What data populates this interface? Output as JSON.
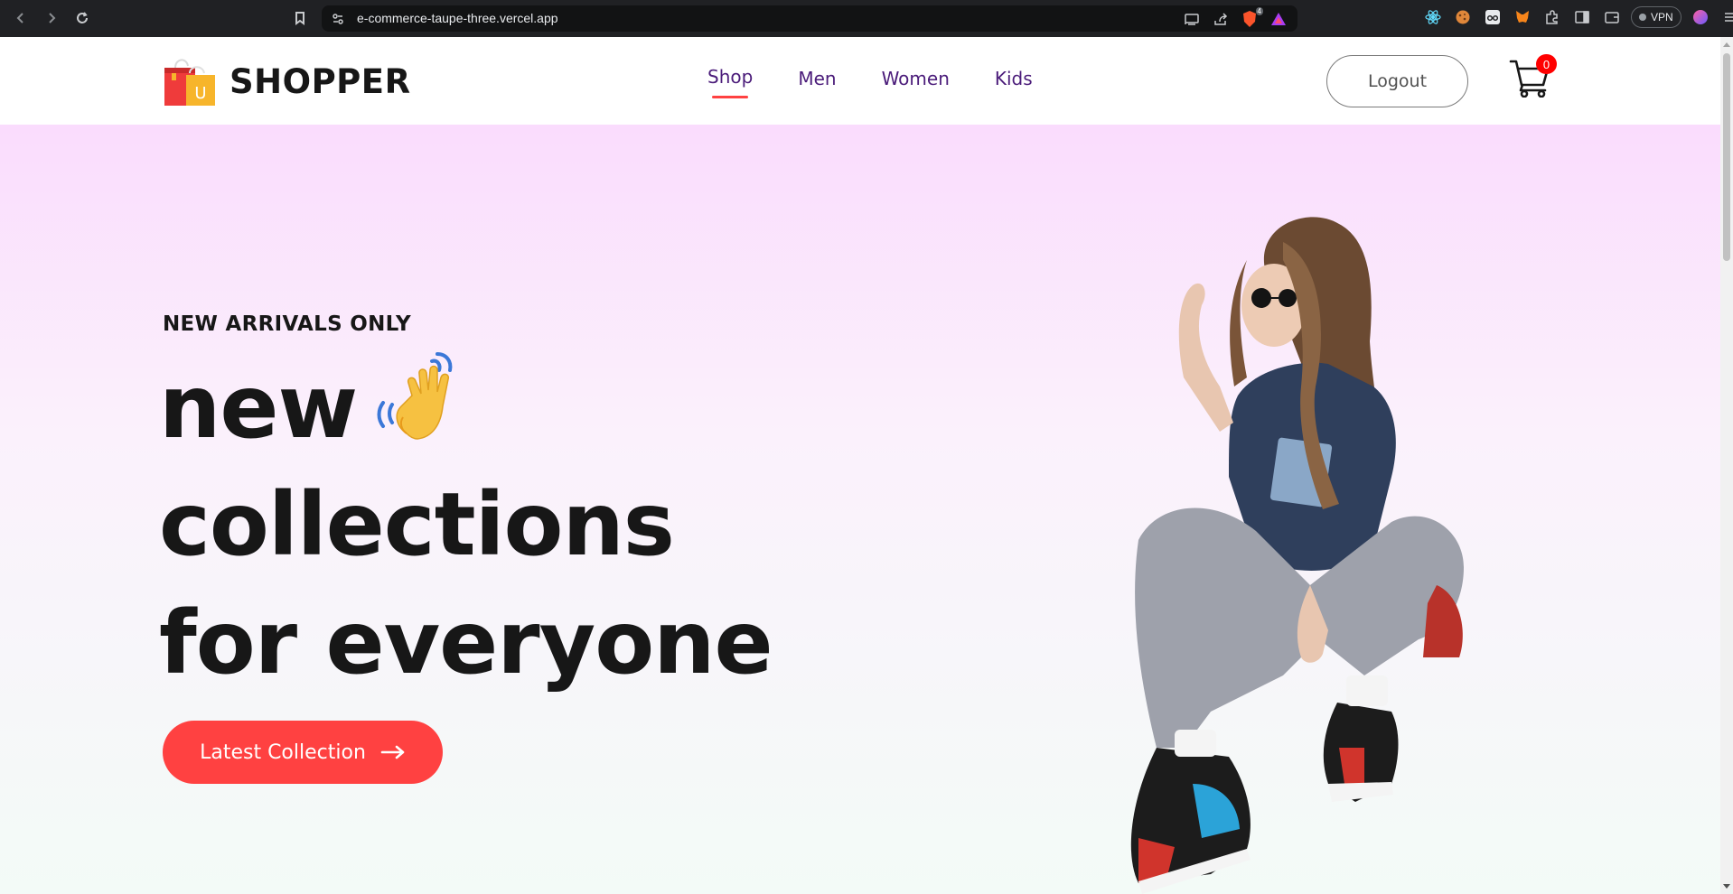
{
  "browser": {
    "url": "e-commerce-taupe-three.vercel.app",
    "vpn_label": "VPN",
    "brave_badge": "4"
  },
  "header": {
    "brand": "SHOPPER",
    "nav": [
      {
        "label": "Shop",
        "active": true
      },
      {
        "label": "Men",
        "active": false
      },
      {
        "label": "Women",
        "active": false
      },
      {
        "label": "Kids",
        "active": false
      }
    ],
    "logout_label": "Logout",
    "cart_count": "0"
  },
  "hero": {
    "tagline": "NEW ARRIVALS ONLY",
    "line1": "new",
    "line2": "collections",
    "line3": "for everyone",
    "cta_label": "Latest Collection"
  },
  "colors": {
    "accent": "#ff4141",
    "nav_text": "#4b1c7a",
    "hero_top": "#fadcfd",
    "hero_bottom": "#f3fbf7"
  }
}
